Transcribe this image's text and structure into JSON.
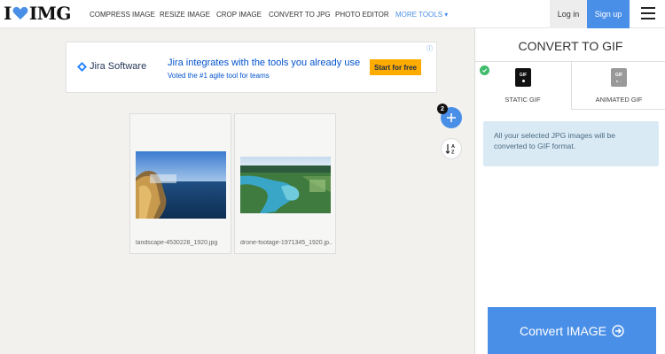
{
  "brand": {
    "logo_text_i": "I",
    "logo_text_img": "IMG"
  },
  "nav": {
    "items": [
      "COMPRESS IMAGE",
      "RESIZE IMAGE",
      "CROP IMAGE",
      "CONVERT TO JPG",
      "PHOTO EDITOR"
    ],
    "more": "MORE TOOLS ▾",
    "login": "Log in",
    "signup": "Sign up"
  },
  "ad": {
    "brand": "Jira Software",
    "headline": "Jira integrates with the tools you already use",
    "subline": "Voted the #1 agile tool for teams",
    "cta": "Start for free",
    "info": "ⓘ"
  },
  "files": [
    {
      "name": "landscape-4530228_1920.jpg"
    },
    {
      "name": "drone-footage-1971345_1920.jp..."
    }
  ],
  "controls": {
    "file_count": "2"
  },
  "sidebar": {
    "title": "CONVERT TO GIF",
    "options": [
      {
        "label": "STATIC GIF",
        "icon_text": "GIF",
        "selected": true
      },
      {
        "label": "ANIMATED GIF",
        "icon_text": "GIF",
        "selected": false
      }
    ],
    "note": "All your selected JPG images will be converted to GIF format.",
    "convert_label": "Convert IMAGE"
  },
  "colors": {
    "accent": "#4a8fe7",
    "note_bg": "#d9eaf5",
    "check": "#3fbb6c",
    "ad_cta": "#ffab00"
  }
}
